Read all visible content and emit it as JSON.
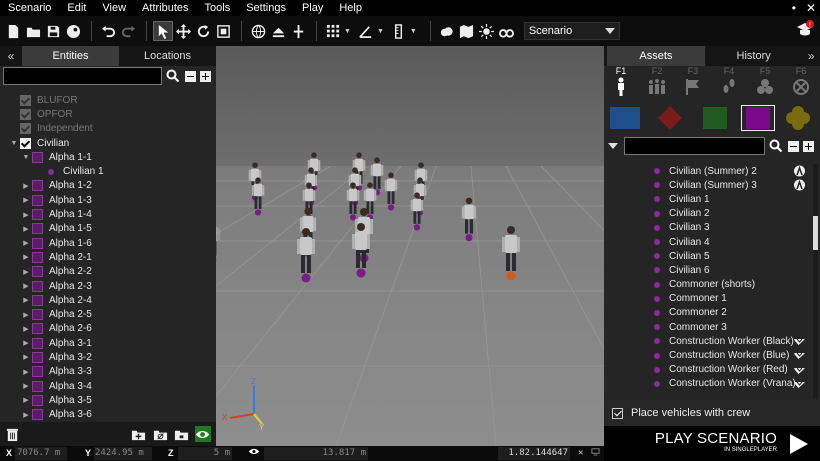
{
  "menu": [
    "Scenario",
    "Edit",
    "View",
    "Attributes",
    "Tools",
    "Settings",
    "Play",
    "Help"
  ],
  "toolbar": {
    "mode_value": "Scenario"
  },
  "left_panel": {
    "tabs": [
      "Entities",
      "Locations"
    ],
    "collapse_label": "«",
    "tree": [
      {
        "label": "BLUFOR",
        "kind": "side-dim"
      },
      {
        "label": "OPFOR",
        "kind": "side-dim"
      },
      {
        "label": "Independent",
        "kind": "side-dim"
      },
      {
        "label": "Civilian",
        "kind": "side"
      },
      {
        "label": "Alpha 1-1",
        "kind": "group-open"
      },
      {
        "label": "Civilian 1",
        "kind": "unit"
      },
      {
        "label": "Alpha 1-2",
        "kind": "group"
      },
      {
        "label": "Alpha 1-3",
        "kind": "group"
      },
      {
        "label": "Alpha 1-4",
        "kind": "group"
      },
      {
        "label": "Alpha 1-5",
        "kind": "group"
      },
      {
        "label": "Alpha 1-6",
        "kind": "group"
      },
      {
        "label": "Alpha 2-1",
        "kind": "group"
      },
      {
        "label": "Alpha 2-2",
        "kind": "group"
      },
      {
        "label": "Alpha 2-3",
        "kind": "group"
      },
      {
        "label": "Alpha 2-4",
        "kind": "group"
      },
      {
        "label": "Alpha 2-5",
        "kind": "group"
      },
      {
        "label": "Alpha 2-6",
        "kind": "group"
      },
      {
        "label": "Alpha 3-1",
        "kind": "group"
      },
      {
        "label": "Alpha 3-2",
        "kind": "group"
      },
      {
        "label": "Alpha 3-3",
        "kind": "group"
      },
      {
        "label": "Alpha 3-4",
        "kind": "group"
      },
      {
        "label": "Alpha 3-5",
        "kind": "group"
      },
      {
        "label": "Alpha 3-6",
        "kind": "group"
      }
    ]
  },
  "right_panel": {
    "tabs": [
      "Assets",
      "History"
    ],
    "collapse_label": "»",
    "fkeys": [
      "F1",
      "F2",
      "F3",
      "F4",
      "F5",
      "F6"
    ],
    "side_colors": [
      "#1f4f8a",
      "#7a1a1a",
      "#1f5a1f",
      "#7a0a8a",
      "#7a6a10"
    ],
    "assets": [
      {
        "label": "Civilian (Summer) 2",
        "icon": "person-circle-icon"
      },
      {
        "label": "Civilian (Summer) 3",
        "icon": "person-circle-icon"
      },
      {
        "label": "Civilian 1",
        "icon": ""
      },
      {
        "label": "Civilian 2",
        "icon": ""
      },
      {
        "label": "Civilian 3",
        "icon": ""
      },
      {
        "label": "Civilian 4",
        "icon": ""
      },
      {
        "label": "Civilian 5",
        "icon": ""
      },
      {
        "label": "Civilian 6",
        "icon": ""
      },
      {
        "label": "Commoner (shorts)",
        "icon": ""
      },
      {
        "label": "Commoner 1",
        "icon": ""
      },
      {
        "label": "Commoner 2",
        "icon": ""
      },
      {
        "label": "Commoner 3",
        "icon": ""
      },
      {
        "label": "Construction Worker (Black)",
        "icon": "hardhat-icon"
      },
      {
        "label": "Construction Worker (Blue)",
        "icon": "hardhat-icon"
      },
      {
        "label": "Construction Worker (Red)",
        "icon": "hardhat-icon"
      },
      {
        "label": "Construction Worker (Vrana)",
        "icon": "hardhat-icon"
      }
    ],
    "crew_label": "Place vehicles with crew"
  },
  "play": {
    "title": "PLAY SCENARIO",
    "subtitle": "IN SINGLEPLAYER"
  },
  "status": {
    "x_label": "X",
    "x_value": "7076.7 m",
    "y_label": "Y",
    "y_value": "2424.95 m",
    "z_label": "Z",
    "z_value": "5 m",
    "dist_value": "13.817 m",
    "version": "1.82.144647"
  },
  "viewport": {
    "axis_labels": [
      "Z",
      "X",
      "Y"
    ],
    "axis_colors": {
      "x": "#e23a2a",
      "y": "#e6d23a",
      "z": "#3a7be2"
    },
    "marker_color": "#7a1c8a",
    "selected_color": "#d65a1a"
  }
}
